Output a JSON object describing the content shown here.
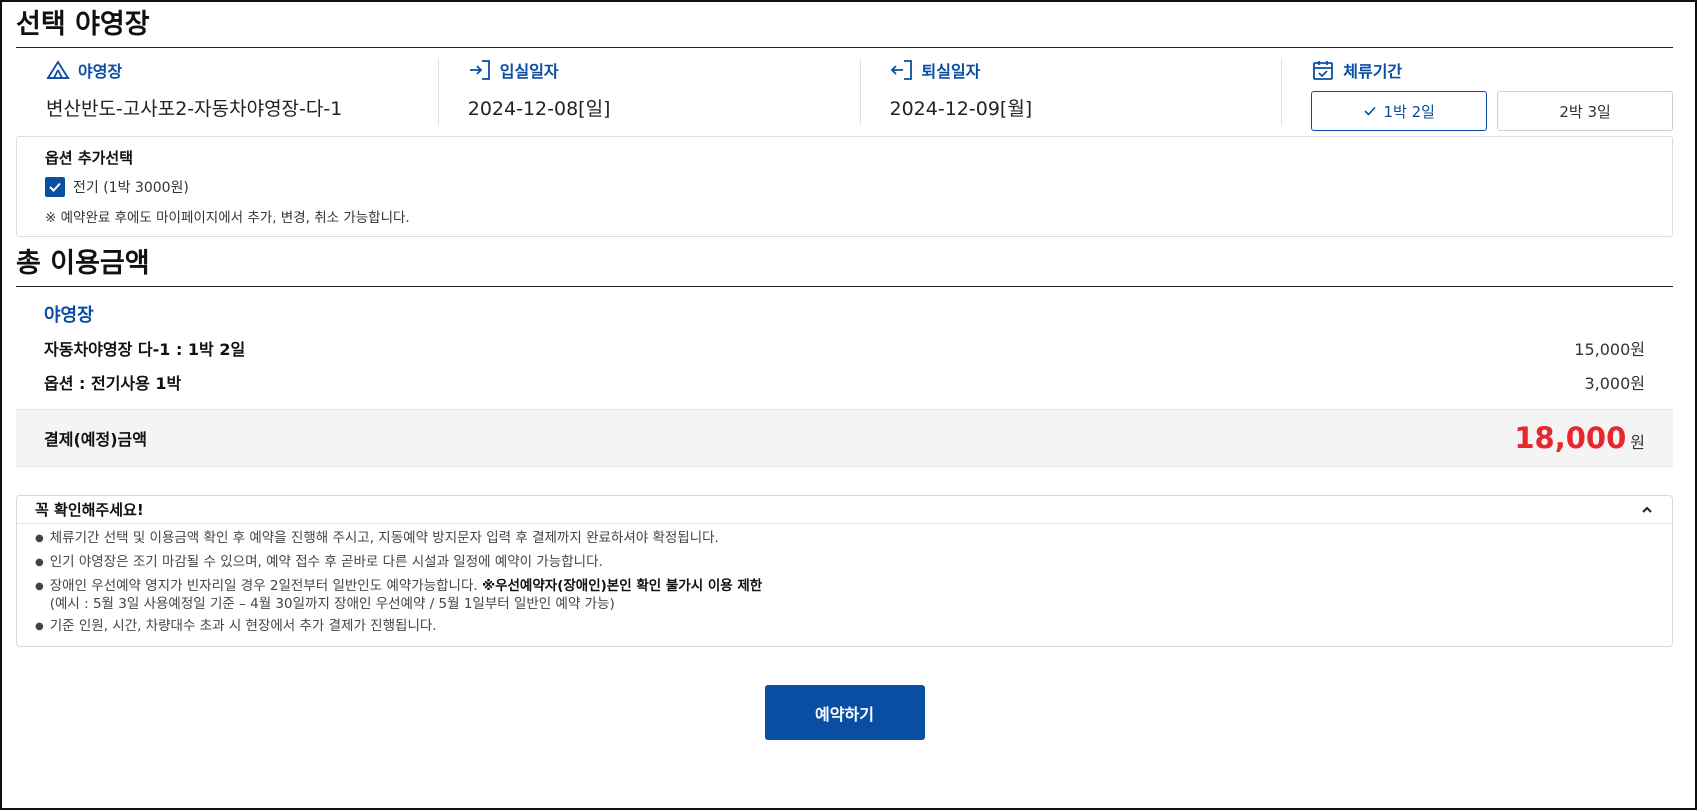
{
  "selected_campsite": {
    "title": "선택 야영장",
    "campsite_label": "야영장",
    "campsite_value": "변산반도-고사포2-자동차야영장-다-1",
    "checkin_label": "입실일자",
    "checkin_value": "2024-12-08[일]",
    "checkout_label": "퇴실일자",
    "checkout_value": "2024-12-09[월]",
    "stay_label": "체류기간",
    "stay_options": [
      {
        "label": "1박 2일",
        "selected": true
      },
      {
        "label": "2박 3일",
        "selected": false
      }
    ]
  },
  "options": {
    "title": "옵션 추가선택",
    "electric_label": "전기 (1박 3000원)",
    "electric_checked": true,
    "note": "※ 예약완료 후에도 마이페이지에서 추가, 변경, 취소 가능합니다."
  },
  "total": {
    "title": "총 이용금액",
    "category": "야영장",
    "lines": [
      {
        "label": "자동차야영장 다-1 : 1박 2일",
        "amount": "15,000원"
      },
      {
        "label": "옵션 : 전기사용 1박",
        "amount": "3,000원"
      }
    ],
    "payment_label": "결제(예정)금액",
    "payment_amount": "18,000",
    "payment_unit": "원"
  },
  "notice": {
    "title": "꼭 확인해주세요!",
    "items": {
      "item1": "체류기간 선택 및 이용금액 확인 후 예약을 진행해 주시고, 지동예약 방지문자 입력 후 결제까지 완료하셔야 확정됩니다.",
      "item2": "인기 야영장은 조기 마감될 수 있으며, 예약 접수 후 곧바로 다른 시설과 일정에 예약이 가능합니다.",
      "item3_text": "장애인 우선예약 영지가 빈자리일 경우 2일전부터 일반인도 예약가능합니다. ",
      "item3_bold": "※우선예약자(장애인)본인 확인 불가시 이용 제한",
      "item3_sub": "(예시 : 5월 3일 사용예정일 기준 – 4월 30일까지 장애인 우선예약 / 5월 1일부터 일반인 예약 가능)",
      "item4": "기준 인원, 시간, 차량대수 초과 시 현장에서 추가 결제가 진행됩니다."
    }
  },
  "reserve_button": "예약하기",
  "colors": {
    "accent": "#0a4ea3",
    "price": "#e8262d"
  }
}
